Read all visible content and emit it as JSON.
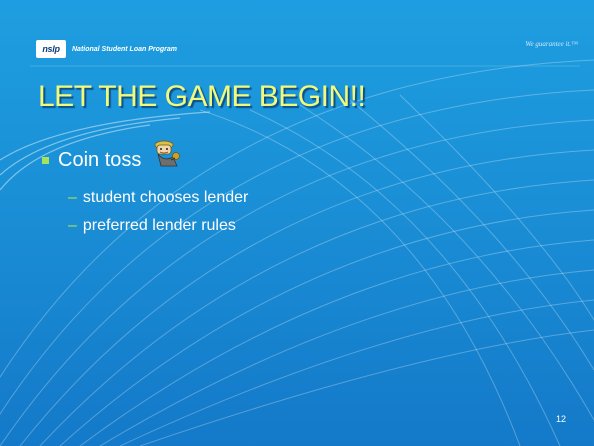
{
  "header": {
    "logo_text": "nslp",
    "logo_name": "National Student Loan Program",
    "tagline": "We guarantee it.™"
  },
  "slide": {
    "title": "LET THE GAME BEGIN!!",
    "bullet": "Coin toss",
    "sub_items": [
      {
        "dash": "–",
        "text": "student chooses lender"
      },
      {
        "dash": "–",
        "text": "preferred lender rules"
      }
    ],
    "page_number": "12"
  },
  "colors": {
    "background": "#1a8fd6",
    "title": "#f1fa7a",
    "accent": "#a6e35b"
  },
  "icons": {
    "bullet": "coin-toss-clipart-icon"
  }
}
